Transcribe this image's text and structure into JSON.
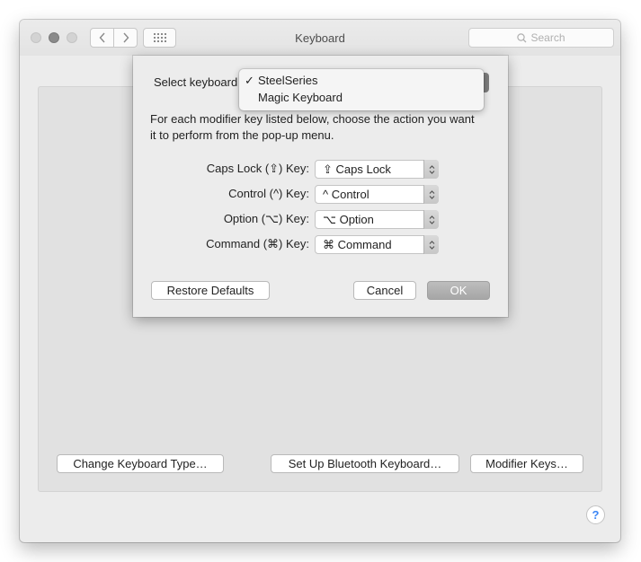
{
  "window": {
    "title": "Keyboard",
    "search_placeholder": "Search",
    "nav_back_glyph": "‹",
    "nav_forward_glyph": "›",
    "grid_glyph": "⠿"
  },
  "main": {
    "change_keyboard_type_label": "Change Keyboard Type…",
    "setup_bluetooth_label": "Set Up Bluetooth Keyboard…",
    "modifier_keys_label": "Modifier Keys…",
    "help_label": "?"
  },
  "sheet": {
    "select_keyboard_label": "Select keyboard",
    "keyboards": [
      {
        "label": "SteelSeries",
        "checked": true,
        "check_glyph": "✓"
      },
      {
        "label": "Magic Keyboard",
        "checked": false,
        "check_glyph": ""
      }
    ],
    "description": "For each modifier key listed below, choose the action you want it to perform from the pop-up menu.",
    "rows": [
      {
        "label": "Caps Lock (⇪) Key:",
        "value": "⇪ Caps Lock"
      },
      {
        "label": "Control (^) Key:",
        "value": "^ Control"
      },
      {
        "label": "Option (⌥) Key:",
        "value": "⌥ Option"
      },
      {
        "label": "Command (⌘) Key:",
        "value": "⌘ Command"
      }
    ],
    "restore_defaults_label": "Restore Defaults",
    "cancel_label": "Cancel",
    "ok_label": "OK"
  },
  "colors": {
    "window_bg": "#ececec",
    "pane_bg": "#e1e1e1",
    "help_accent": "#3b86f5",
    "ok_button_bg": "#a6a6a6"
  },
  "icons": [
    "close-light",
    "minimize-light",
    "zoom-light",
    "chevron-left-icon",
    "chevron-right-icon",
    "grid-icon",
    "search-icon",
    "stepper-icon",
    "help-icon"
  ]
}
